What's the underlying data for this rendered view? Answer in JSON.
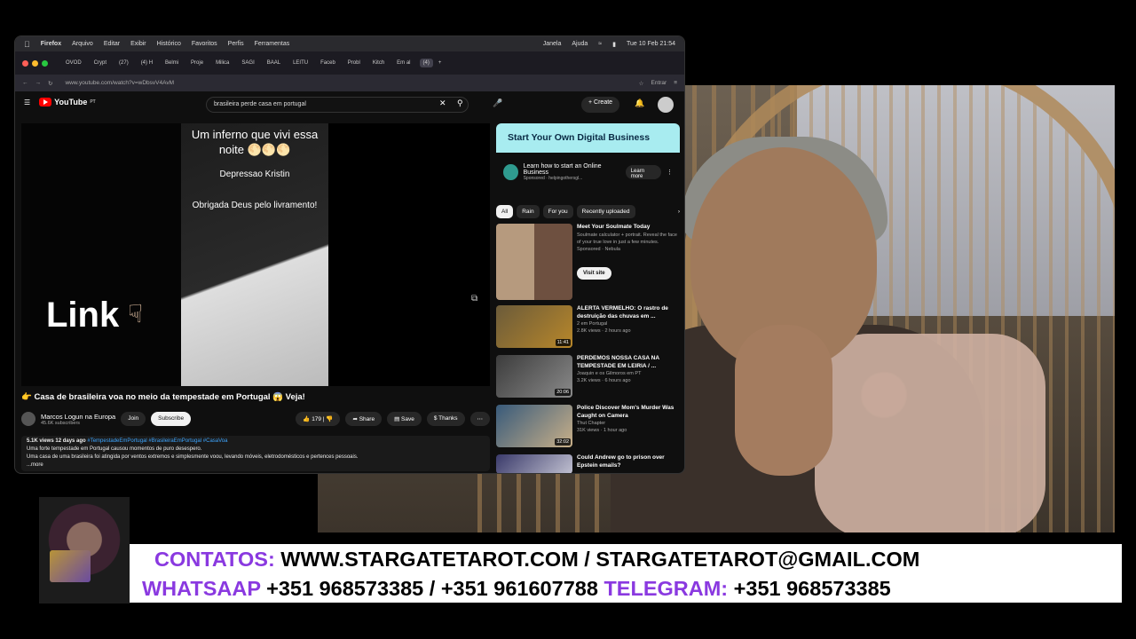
{
  "colors": {
    "accent_purple": "#8a39e0",
    "yt_red": "#ff0000",
    "ad_banner": "#a8ecf0"
  },
  "browser": {
    "menu": [
      "Firefox",
      "Arquivo",
      "Editar",
      "Exibir",
      "Histórico",
      "Favoritos",
      "Perfis",
      "Ferramentas"
    ],
    "menu_right": [
      "Janela",
      "Ajuda"
    ],
    "clock": "Tue 10 Feb 21:54",
    "tabs": [
      "OVOD",
      "Crypt",
      "(27)",
      "(4) H",
      "Belmi",
      "Proje",
      "Milica",
      "SAGI",
      "BAAL",
      "LEITU",
      "Faceb",
      "Probl",
      "Kitch",
      "Em al",
      "(4)"
    ],
    "url": "www.youtube.com/watch?v=wDbsvV4AvM",
    "signin": "Entrar"
  },
  "youtube": {
    "logo": "YouTube",
    "region": "PT",
    "search_value": "brasileira perde casa em portugal",
    "create": "Create",
    "video": {
      "overlay_title": "Um inferno que vivi essa noite 🌕🌕🌕",
      "overlay_sub": "Depressao Kristin",
      "overlay_thanks": "Obrigada Deus pelo livramento!",
      "link_text": "Link"
    },
    "title": "👉 Casa de brasileira voa no meio da tempestade em Portugal 😱 Veja!",
    "channel": "Marcos Logun na Europa",
    "subs": "45.6K subscribers",
    "join": "Join",
    "subscribe": "Subscribe",
    "likes": "179",
    "share": "Share",
    "save": "Save",
    "thanks": "Thanks",
    "desc_meta": "5.1K views  12 days ago",
    "desc_tags": "#TempestadeEmPortugal #BrasileiraEmPortugal #CasaVoa",
    "desc_line1": "Uma forte tempestade em Portugal causou momentos de puro desespero.",
    "desc_line2": "Uma casa de uma brasileira foi atingida por ventos extremos e simplesmente voou, levando móveis, eletrodomésticos e pertences pessoais.",
    "more": "...more",
    "ad": {
      "banner": "Start Your Own Digital Business",
      "text": "Learn how to start an Online Business",
      "sponsored": "Sponsored · helpingothersgl...",
      "learn": "Learn more"
    },
    "chips": [
      "All",
      "Rain",
      "For you",
      "Recently uploaded"
    ],
    "related": [
      {
        "title": "Meet Your Soulmate Today",
        "meta1": "Soulmate calculator + portrait. Reveal the face of your true love in just a few minutes.",
        "meta2": "Sponsored · Nebula",
        "dur": "",
        "cta": "Visit site"
      },
      {
        "title": "ALERTA VERMELHO: O rastro de destruição das chuvas em ...",
        "meta1": "2 em Portugal",
        "meta2": "2.8K views · 2 hours ago",
        "dur": "11:41",
        "cta": ""
      },
      {
        "title": "PERDEMOS NOSSA CASA NA TEMPESTADE EM LEIRIA / ...",
        "meta1": "Joaquin e os Gilmoros em PT",
        "meta2": "3.2K views · 6 hours ago",
        "dur": "20:06",
        "cta": ""
      },
      {
        "title": "Police Discover Mom's Murder Was Caught on Camera",
        "meta1": "Thut Chapter",
        "meta2": "31K views · 1 hour ago",
        "dur": "32:02",
        "cta": ""
      },
      {
        "title": "Could Andrew go to prison over Epstein emails?",
        "meta1": "",
        "meta2": "",
        "dur": "",
        "cta": ""
      }
    ]
  },
  "banner": {
    "contatos_label": "CONTATOS:",
    "contatos_value": " WWW.STARGATETAROT.COM / STARGATETAROT@GMAIL.COM",
    "whatsapp_label": "WHATSAAP",
    "whatsapp_value": " +351 968573385 / +351 961607788 ",
    "telegram_label": " TELEGRAM:",
    "telegram_value": " +351 968573385"
  }
}
